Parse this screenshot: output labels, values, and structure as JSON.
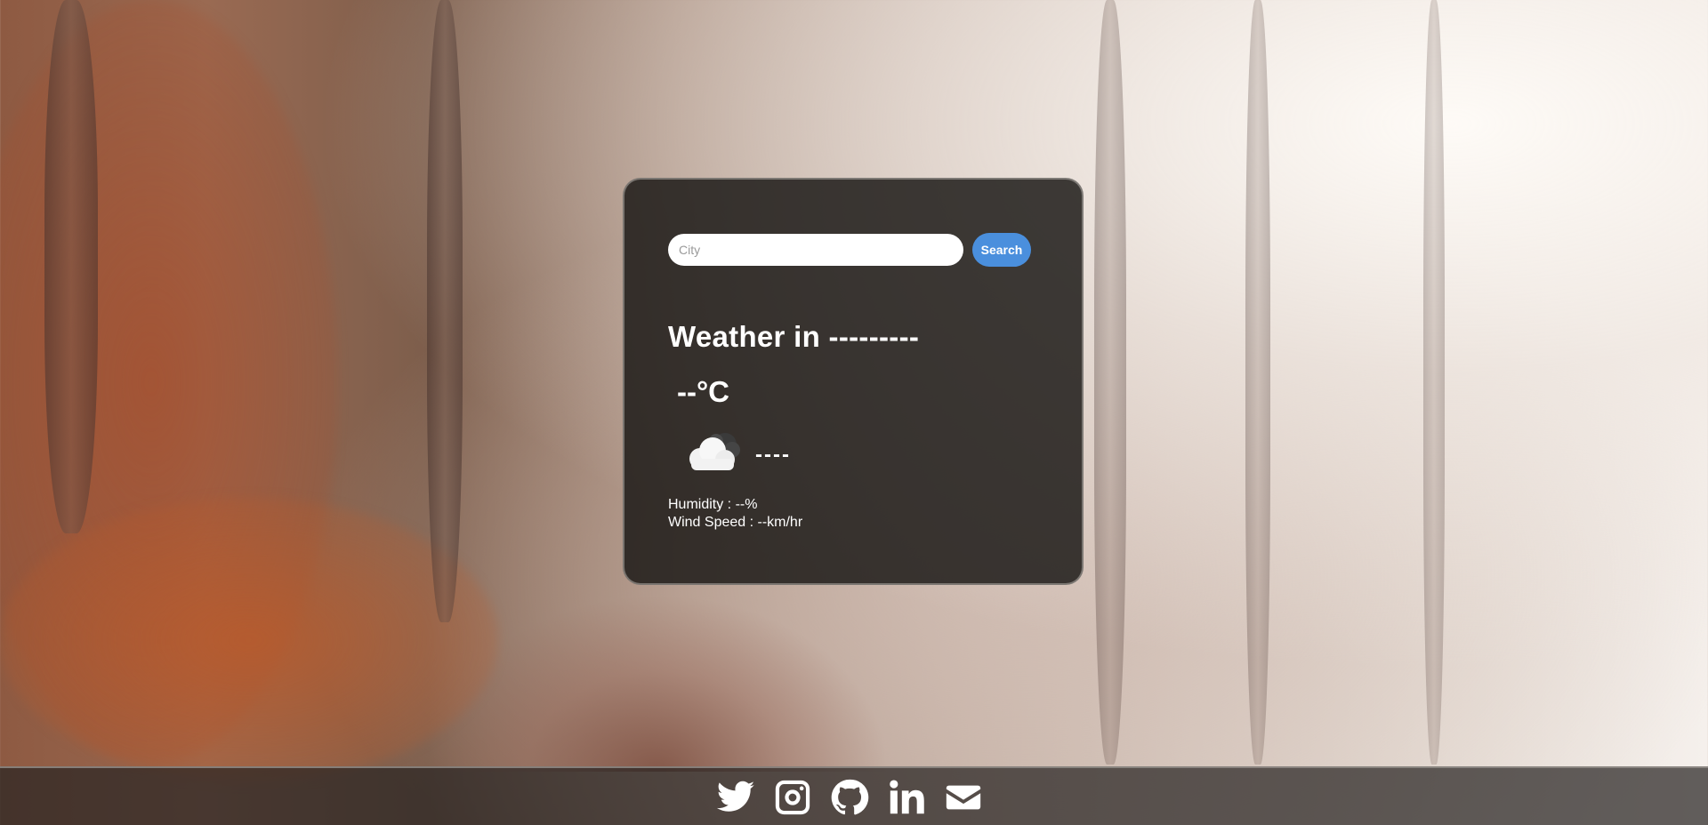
{
  "search": {
    "placeholder": "City",
    "value": "",
    "button_label": "Search",
    "button_color": "#4a8fdd"
  },
  "weather": {
    "title": "Weather in ---------",
    "temperature": "--°C",
    "icon": "cloud-icon",
    "description": "----",
    "humidity": "Humidity : --%",
    "wind_speed": "Wind Speed : --km/hr"
  },
  "footer": {
    "links": [
      {
        "icon": "twitter-icon"
      },
      {
        "icon": "instagram-icon"
      },
      {
        "icon": "github-icon"
      },
      {
        "icon": "linkedin-icon"
      },
      {
        "icon": "email-icon"
      }
    ]
  }
}
